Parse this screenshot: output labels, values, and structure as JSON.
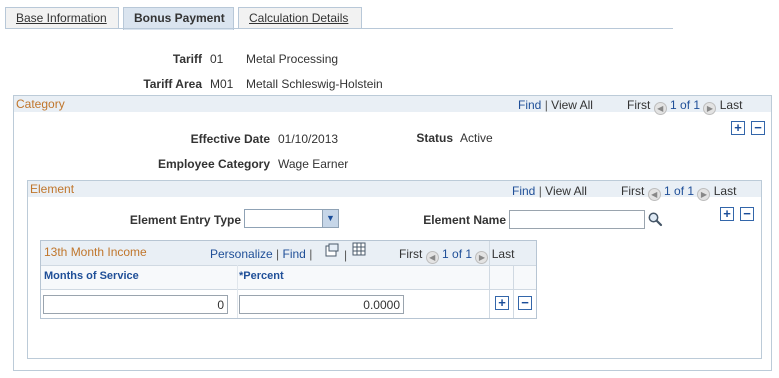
{
  "tabs": [
    {
      "label": "Base Information"
    },
    {
      "label": "Bonus Payment"
    },
    {
      "label": "Calculation Details"
    }
  ],
  "header": {
    "tariff_label": "Tariff",
    "tariff_code": "01",
    "tariff_desc": "Metal Processing",
    "area_label": "Tariff Area",
    "area_code": "M01",
    "area_desc": "Metall Schleswig-Holstein"
  },
  "category": {
    "title": "Category",
    "find": "Find",
    "view_all": "View All",
    "first": "First",
    "count": "1 of 1",
    "last": "Last",
    "effective_date_label": "Effective Date",
    "effective_date": "01/10/2013",
    "status_label": "Status",
    "status": "Active",
    "employee_category_label": "Employee Category",
    "employee_category": "Wage Earner"
  },
  "element": {
    "title": "Element",
    "find": "Find",
    "view_all": "View All",
    "first": "First",
    "count": "1 of 1",
    "last": "Last",
    "entry_type_label": "Element Entry Type",
    "entry_type_value": "",
    "name_label": "Element Name",
    "name_value": ""
  },
  "grid": {
    "title": "13th Month Income",
    "personalize": "Personalize",
    "find": "Find",
    "first": "First",
    "count": "1 of 1",
    "last": "Last",
    "col_months": "Months of Service",
    "col_percent": "*Percent",
    "rows": [
      {
        "months": "0",
        "percent": "0.0000"
      }
    ]
  },
  "icons": {
    "search": "magnifier-icon",
    "add": "plus-icon",
    "delete": "minus-icon",
    "view_grid": "new-window-icon",
    "download": "spreadsheet-icon"
  }
}
